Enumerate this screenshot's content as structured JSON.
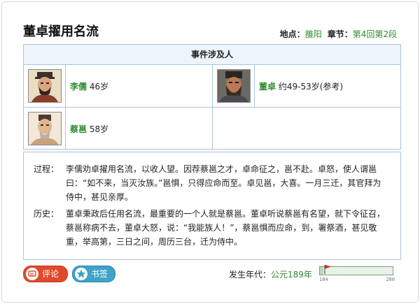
{
  "title": "董卓擢用名流",
  "meta": {
    "location_label": "地点：",
    "location_value": "雒阳",
    "chapter_label": "章节：",
    "chapter_value": "第4回第2段"
  },
  "people": {
    "header": "事件涉及人",
    "items": [
      {
        "name": "李儒",
        "age": "46岁"
      },
      {
        "name": "董卓",
        "age": "约49-53岁(参考)"
      },
      {
        "name": "蔡邕",
        "age": "58岁"
      }
    ]
  },
  "description": {
    "process_label": "过程：",
    "process_text": "李儒劝卓擢用名流，以收人望。因荐蔡邕之才，卓命征之，邕不赴。卓怒，使人谓邕曰：“如不来，当灭汝族。”邕惧，只得应命而至。卓见邕，大喜。一月三迁，其官拜为侍中，甚见亲厚。",
    "history_label": "历史：",
    "history_text": "董卓秉政后任用名流，最重要的一个人就是蔡邕。董卓听说蔡邕有名望，就下令征召，蔡邕称病不去，董卓大怒，说：“我能族人！”，蔡邕惧而应命，到，署祭酒，甚见敬重，举高第，三日之间，周历三台，迁为侍中。"
  },
  "footer": {
    "comment_label": "评论",
    "bookmark_label": "书签",
    "era_label": "发生年代：",
    "era_value": "公元189年",
    "timeline": {
      "start": "184",
      "end": "280",
      "value": 189,
      "min": 184,
      "max": 280
    }
  },
  "colors": {
    "accent_green": "#2e8b2e",
    "border_blue": "#a9c4e0",
    "comment_red": "#e04a2a",
    "bookmark_blue": "#3ea2c9"
  },
  "icons": {
    "comment": "comment-icon",
    "bookmark": "star-icon",
    "timeline_marker": "flag-icon"
  }
}
